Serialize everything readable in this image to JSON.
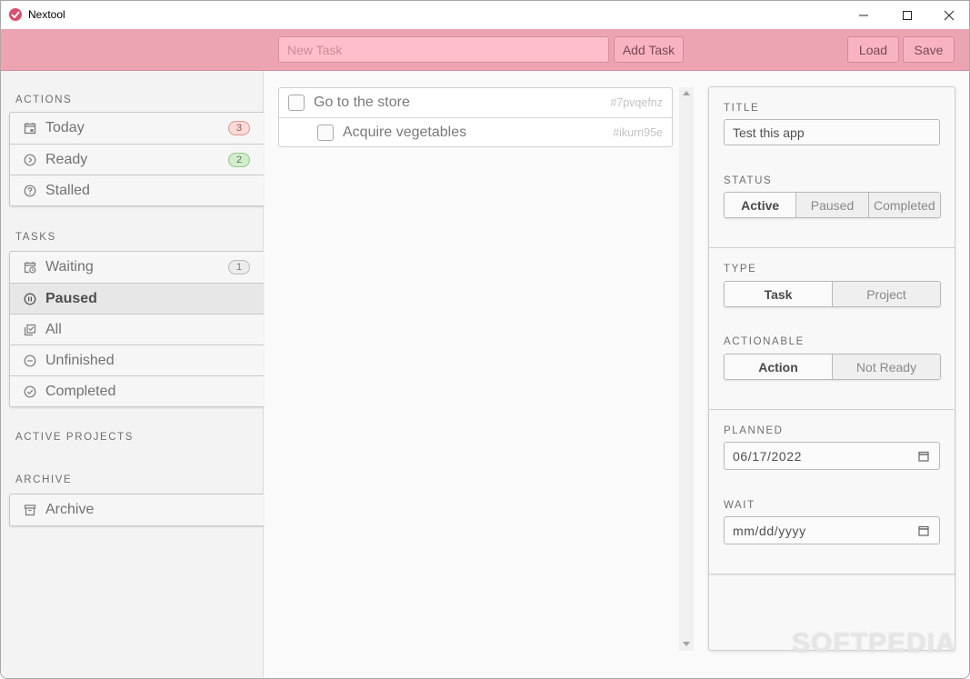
{
  "window": {
    "title": "Nextool",
    "controls": [
      "minimize",
      "maximize",
      "close"
    ]
  },
  "toolbar": {
    "new_task_placeholder": "New Task",
    "new_task_value": "",
    "add_task_label": "Add Task",
    "load_label": "Load",
    "save_label": "Save",
    "accent_color": "#eca4b2"
  },
  "sidebar": {
    "sections": [
      {
        "label": "ACTIONS",
        "items": [
          {
            "label": "Today",
            "icon": "calendar-today-icon",
            "badge": "3",
            "badge_color": "red"
          },
          {
            "label": "Ready",
            "icon": "chevron-circle-right-icon",
            "badge": "2",
            "badge_color": "green"
          },
          {
            "label": "Stalled",
            "icon": "help-circle-icon"
          }
        ]
      },
      {
        "label": "TASKS",
        "items": [
          {
            "label": "Waiting",
            "icon": "calendar-clock-icon",
            "badge": "1",
            "badge_color": "gray"
          },
          {
            "label": "Paused",
            "icon": "pause-circle-icon",
            "active": true
          },
          {
            "label": "All",
            "icon": "checkbox-multiple-icon"
          },
          {
            "label": "Unfinished",
            "icon": "minus-circle-icon"
          },
          {
            "label": "Completed",
            "icon": "check-circle-icon"
          }
        ]
      },
      {
        "label": "ACTIVE PROJECTS",
        "items": []
      },
      {
        "label": "ARCHIVE",
        "items": [
          {
            "label": "Archive",
            "icon": "archive-icon"
          }
        ]
      }
    ]
  },
  "tasks": [
    {
      "title": "Go to the store",
      "id": "#7pvqefnz",
      "level": 0,
      "checked": false
    },
    {
      "title": "Acquire vegetables",
      "id": "#ikurn95e",
      "level": 1,
      "checked": false
    }
  ],
  "detail": {
    "title_label": "TITLE",
    "title_value": "Test this app",
    "status_label": "STATUS",
    "status_options": [
      "Active",
      "Paused",
      "Completed"
    ],
    "status_selected": "Active",
    "type_label": "TYPE",
    "type_options": [
      "Task",
      "Project"
    ],
    "type_selected": "Task",
    "actionable_label": "ACTIONABLE",
    "actionable_options": [
      "Action",
      "Not Ready"
    ],
    "actionable_selected": "Action",
    "planned_label": "PLANNED",
    "planned_value": "06/17/2022",
    "wait_label": "WAIT",
    "wait_placeholder": "mm/dd/yyyy"
  },
  "watermark": "SOFTPEDIA"
}
